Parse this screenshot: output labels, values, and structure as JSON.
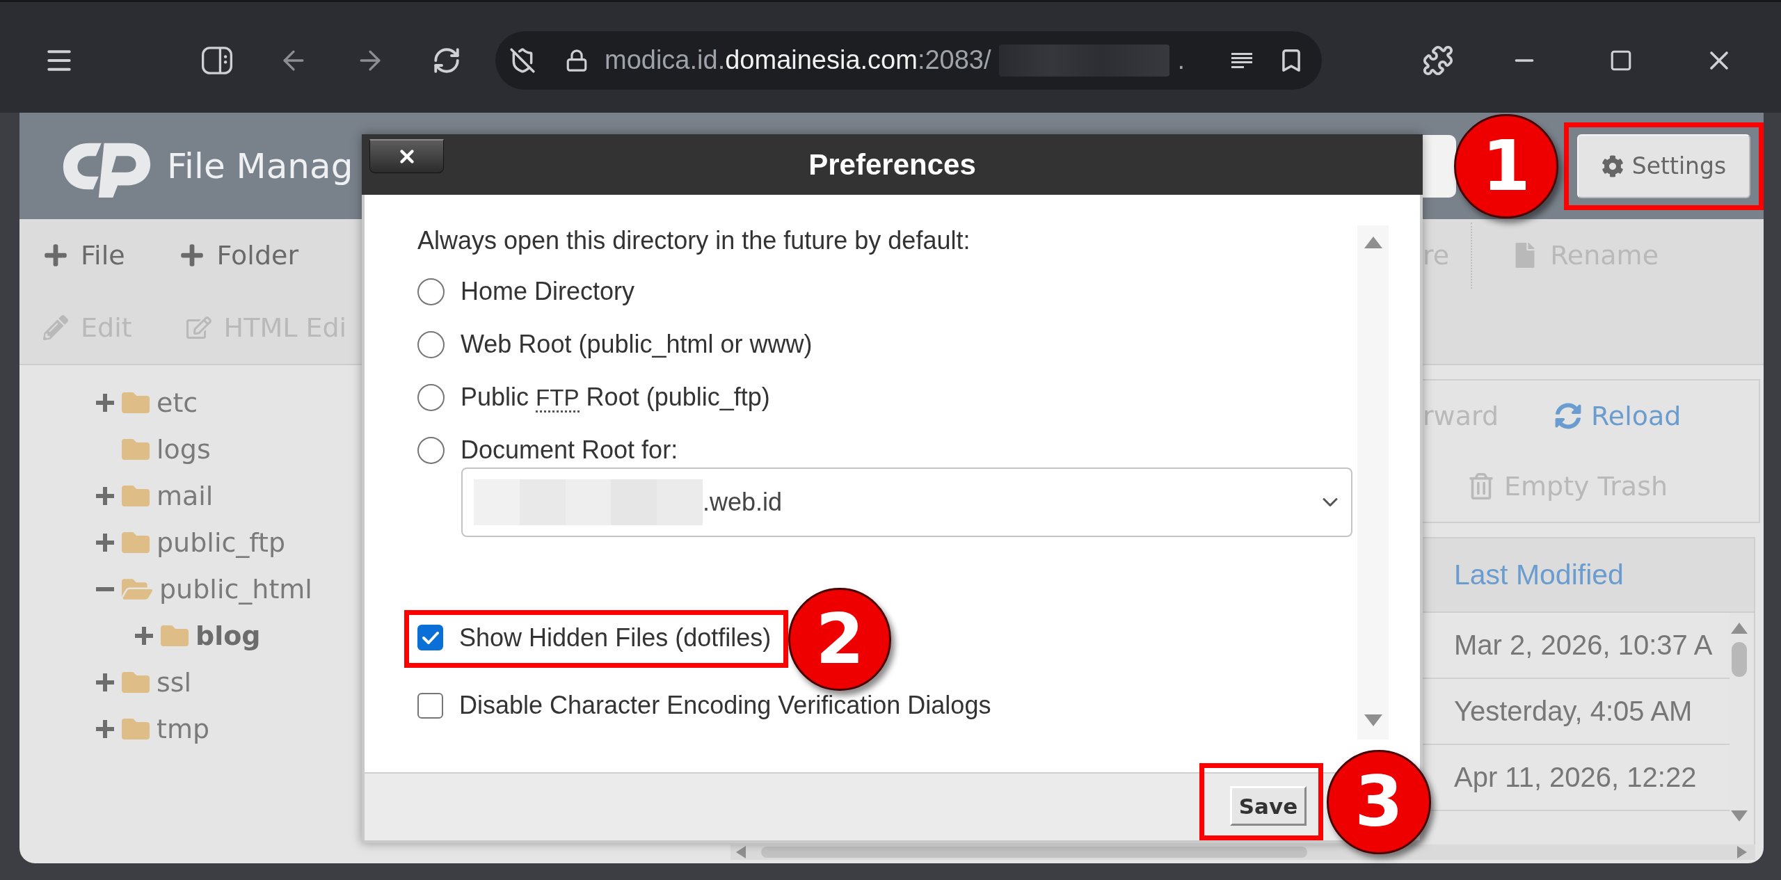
{
  "browser": {
    "address": {
      "host_prefix": "modica.id.",
      "host_domain": "domainesia.com",
      "port_path": ":2083/",
      "after_redaction": "."
    }
  },
  "header": {
    "title": "File Manag",
    "settings_button": {
      "label": "Settings",
      "callout": "1"
    }
  },
  "toolbar": {
    "left_rows": [
      {
        "items": [
          {
            "label": "File",
            "disabled": false
          },
          {
            "label": "Folder",
            "disabled": false
          }
        ]
      },
      {
        "items": [
          {
            "label": "Edit",
            "disabled": true
          },
          {
            "label": "HTML Edi",
            "disabled": true
          }
        ]
      }
    ],
    "right_items": [
      {
        "label": "re",
        "disabled": true
      },
      {
        "label": "Rename",
        "disabled": true
      }
    ]
  },
  "tree": [
    {
      "name": "etc",
      "expandable": true,
      "expanded": false,
      "selected": false
    },
    {
      "name": "logs",
      "expandable": false,
      "expanded": false,
      "selected": false
    },
    {
      "name": "mail",
      "expandable": true,
      "expanded": false,
      "selected": false
    },
    {
      "name": "public_ftp",
      "expandable": true,
      "expanded": false,
      "selected": false
    },
    {
      "name": "public_html",
      "expandable": true,
      "expanded": true,
      "selected": false,
      "children": [
        {
          "name": "blog",
          "expandable": true,
          "expanded": false,
          "selected": true
        }
      ]
    },
    {
      "name": "ssl",
      "expandable": true,
      "expanded": false,
      "selected": false
    },
    {
      "name": "tmp",
      "expandable": true,
      "expanded": false,
      "selected": false
    }
  ],
  "actions": {
    "rows": [
      {
        "items": [
          {
            "label": "rward",
            "disabled": true
          },
          {
            "label": "Reload",
            "disabled": false
          }
        ]
      },
      {
        "items": [
          {
            "label": "Empty Trash",
            "disabled": true
          }
        ]
      }
    ]
  },
  "table": {
    "columns": [
      {
        "label": "Last Modified"
      }
    ],
    "rows": [
      {
        "cells": [
          "Mar 2, 2026, 10:37 A"
        ]
      },
      {
        "cells": [
          "Yesterday, 4:05 AM"
        ]
      },
      {
        "cells": [
          "Apr 11, 2026, 12:22"
        ]
      }
    ]
  },
  "dialog": {
    "title": "Preferences",
    "prompt": "Always open this directory in the future by default:",
    "directory_options": [
      {
        "label_parts": [
          {
            "text": "Home Directory",
            "abbr": false
          }
        ],
        "selected": false
      },
      {
        "label_parts": [
          {
            "text": "Web Root (public_html or www)",
            "abbr": false
          }
        ],
        "selected": false
      },
      {
        "label_parts": [
          {
            "text": "Public ",
            "abbr": false
          },
          {
            "text": "FTP",
            "abbr": true
          },
          {
            "text": " Root (public_ftp)",
            "abbr": false
          }
        ],
        "selected": false
      },
      {
        "label_parts": [
          {
            "text": "Document Root for:",
            "abbr": false
          }
        ],
        "selected": false,
        "domain_select": {
          "value_suffix": ".web.id"
        }
      }
    ],
    "checkboxes": [
      {
        "label": "Show Hidden Files (dotfiles)",
        "checked": true,
        "callout": "2"
      },
      {
        "label": "Disable Character Encoding Verification Dialogs",
        "checked": false
      }
    ],
    "buttons": [
      {
        "label": "Save",
        "callout": "3"
      }
    ]
  }
}
